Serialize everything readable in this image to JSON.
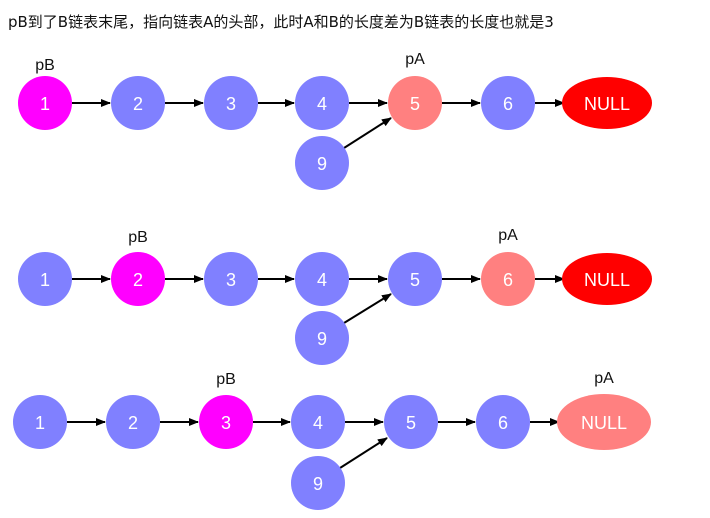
{
  "caption": "pB到了B链表末尾，指向链表A的头部，此时A和B的长度差为B链表的长度也就是3",
  "colors": {
    "node_default": "#8080ff",
    "node_pb": "#ff00ff",
    "node_pa": "#ff8080",
    "null_default": "#ff0000",
    "arrow": "#000000"
  },
  "rows": [
    {
      "nodes": [
        "1",
        "2",
        "3",
        "4",
        "5",
        "6",
        "NULL"
      ],
      "branch_node": "9",
      "pb_label": "pB",
      "pa_label": "pA",
      "pb_index": 0,
      "pa_index": 4
    },
    {
      "nodes": [
        "1",
        "2",
        "3",
        "4",
        "5",
        "6",
        "NULL"
      ],
      "branch_node": "9",
      "pb_label": "pB",
      "pa_label": "pA",
      "pb_index": 1,
      "pa_index": 5
    },
    {
      "nodes": [
        "1",
        "2",
        "3",
        "4",
        "5",
        "6",
        "NULL"
      ],
      "branch_node": "9",
      "pb_label": "pB",
      "pa_label": "pA",
      "pb_index": 2,
      "pa_index": 6
    }
  ]
}
